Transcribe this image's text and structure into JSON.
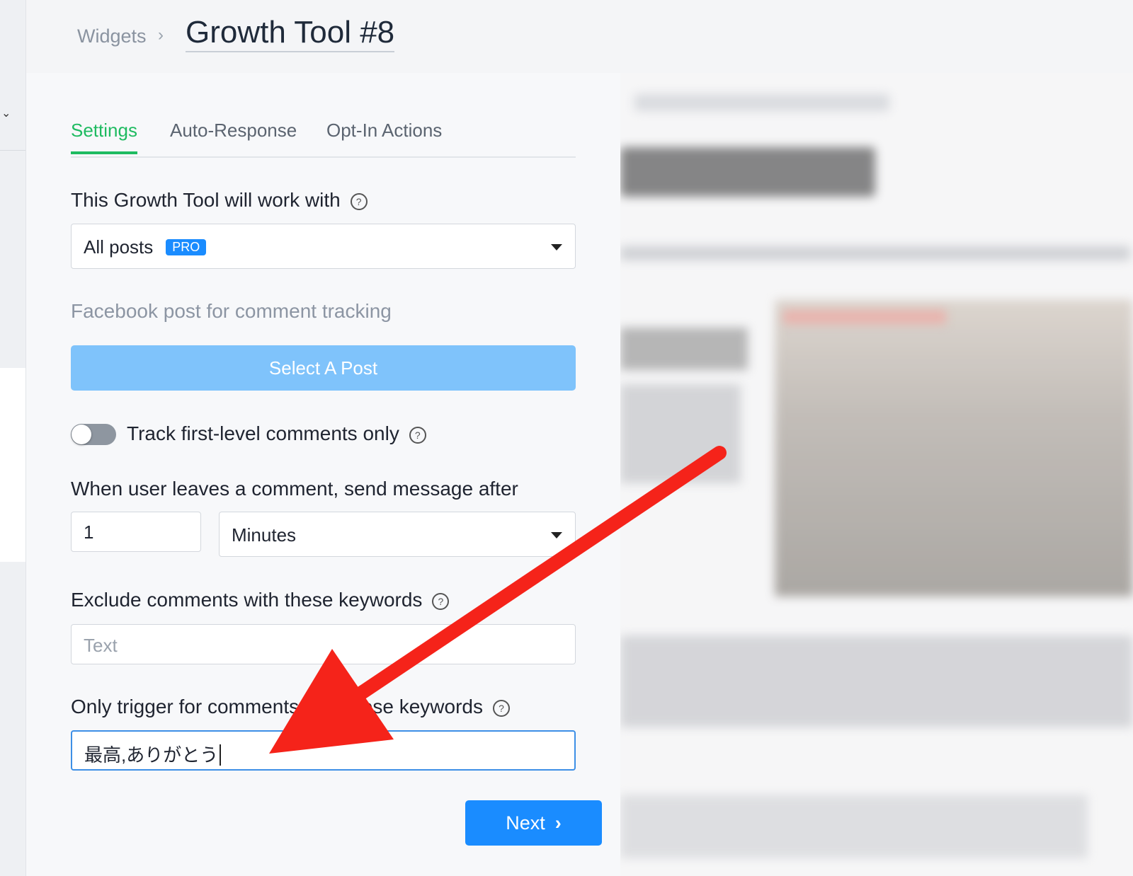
{
  "breadcrumb": {
    "root": "Widgets",
    "separator": "›",
    "title": "Growth Tool #8"
  },
  "tabs": [
    "Settings",
    "Auto-Response",
    "Opt-In Actions"
  ],
  "form": {
    "works_with_label": "This Growth Tool will work with",
    "works_with_value": "All posts",
    "pro_badge": "PRO",
    "fb_post_label": "Facebook post for comment tracking",
    "select_post_button": "Select A Post",
    "toggle_label": "Track first-level comments only",
    "toggle_on": false,
    "delay_label": "When user leaves a comment, send message after",
    "delay_value": "1",
    "delay_unit": "Minutes",
    "exclude_label": "Exclude comments with these keywords",
    "exclude_placeholder": "Text",
    "only_trigger_label": "Only trigger for comments with these keywords",
    "only_trigger_value": "最高,ありがとう",
    "next_button": "Next"
  },
  "icons": {
    "help": "help-circle-icon",
    "chevron_right": "chevron-right-icon",
    "caret_down": "caret-down-icon"
  },
  "colors": {
    "accent_green": "#1fbb61",
    "primary_blue": "#1a8cff",
    "disabled_blue": "#7fc3fb",
    "annotation_red": "#f5231a"
  }
}
